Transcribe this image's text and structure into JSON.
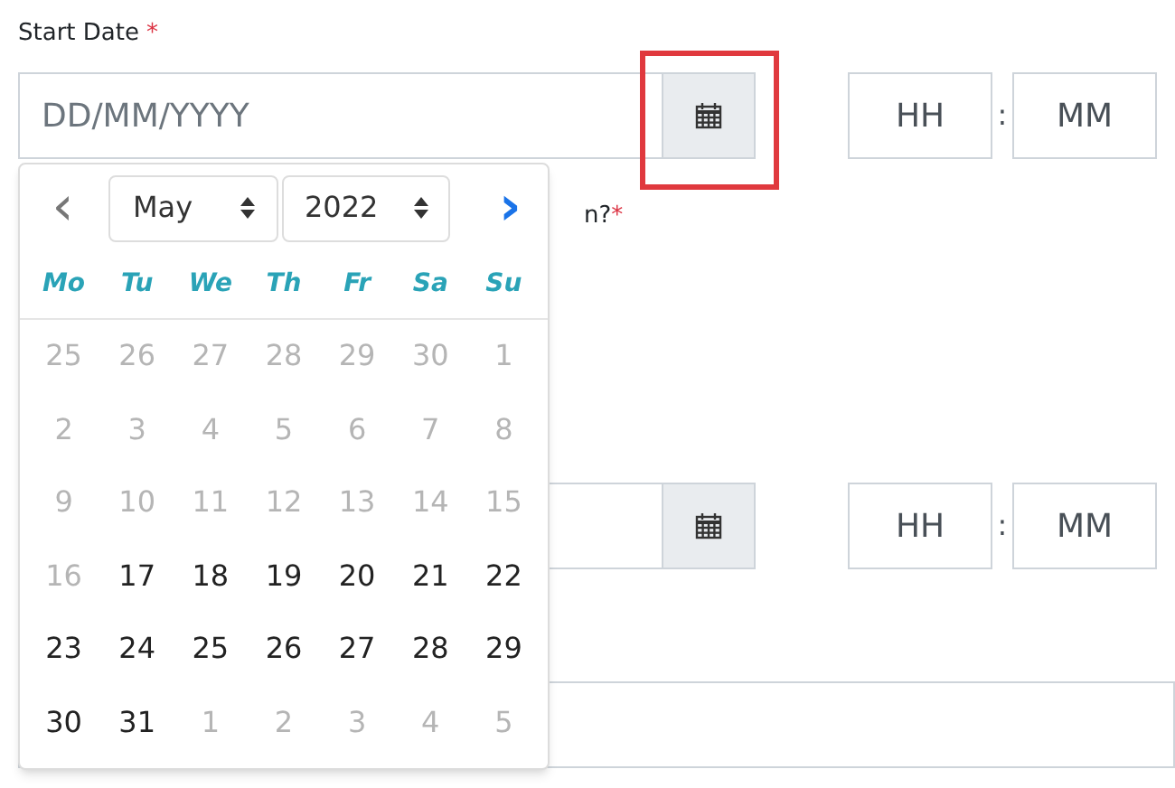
{
  "start_date": {
    "label": "Start Date",
    "required_mark": "*",
    "placeholder": "DD/MM/YYYY",
    "highlighted": true,
    "hour_placeholder": "HH",
    "separator": ":",
    "minute_placeholder": "MM"
  },
  "question_label": {
    "text": "n?",
    "required_mark": "*"
  },
  "end_date": {
    "hour_placeholder": "HH",
    "separator": ":",
    "minute_placeholder": "MM"
  },
  "datepicker": {
    "prev": "‹",
    "next": "›",
    "month": "May",
    "year": "2022",
    "weekdays": [
      "Mo",
      "Tu",
      "We",
      "Th",
      "Fr",
      "Sa",
      "Su"
    ],
    "weeks": [
      [
        {
          "day": "25",
          "disabled": true
        },
        {
          "day": "26",
          "disabled": true
        },
        {
          "day": "27",
          "disabled": true
        },
        {
          "day": "28",
          "disabled": true
        },
        {
          "day": "29",
          "disabled": true
        },
        {
          "day": "30",
          "disabled": true
        },
        {
          "day": "1",
          "disabled": true
        }
      ],
      [
        {
          "day": "2",
          "disabled": true
        },
        {
          "day": "3",
          "disabled": true
        },
        {
          "day": "4",
          "disabled": true
        },
        {
          "day": "5",
          "disabled": true
        },
        {
          "day": "6",
          "disabled": true
        },
        {
          "day": "7",
          "disabled": true
        },
        {
          "day": "8",
          "disabled": true
        }
      ],
      [
        {
          "day": "9",
          "disabled": true
        },
        {
          "day": "10",
          "disabled": true
        },
        {
          "day": "11",
          "disabled": true
        },
        {
          "day": "12",
          "disabled": true
        },
        {
          "day": "13",
          "disabled": true
        },
        {
          "day": "14",
          "disabled": true
        },
        {
          "day": "15",
          "disabled": true
        }
      ],
      [
        {
          "day": "16",
          "disabled": true
        },
        {
          "day": "17",
          "disabled": false
        },
        {
          "day": "18",
          "disabled": false
        },
        {
          "day": "19",
          "disabled": false
        },
        {
          "day": "20",
          "disabled": false
        },
        {
          "day": "21",
          "disabled": false
        },
        {
          "day": "22",
          "disabled": false
        }
      ],
      [
        {
          "day": "23",
          "disabled": false
        },
        {
          "day": "24",
          "disabled": false
        },
        {
          "day": "25",
          "disabled": false
        },
        {
          "day": "26",
          "disabled": false
        },
        {
          "day": "27",
          "disabled": false
        },
        {
          "day": "28",
          "disabled": false
        },
        {
          "day": "29",
          "disabled": false
        }
      ],
      [
        {
          "day": "30",
          "disabled": false
        },
        {
          "day": "31",
          "disabled": false
        },
        {
          "day": "1",
          "disabled": true
        },
        {
          "day": "2",
          "disabled": true
        },
        {
          "day": "3",
          "disabled": true
        },
        {
          "day": "4",
          "disabled": true
        },
        {
          "day": "5",
          "disabled": true
        }
      ]
    ]
  }
}
